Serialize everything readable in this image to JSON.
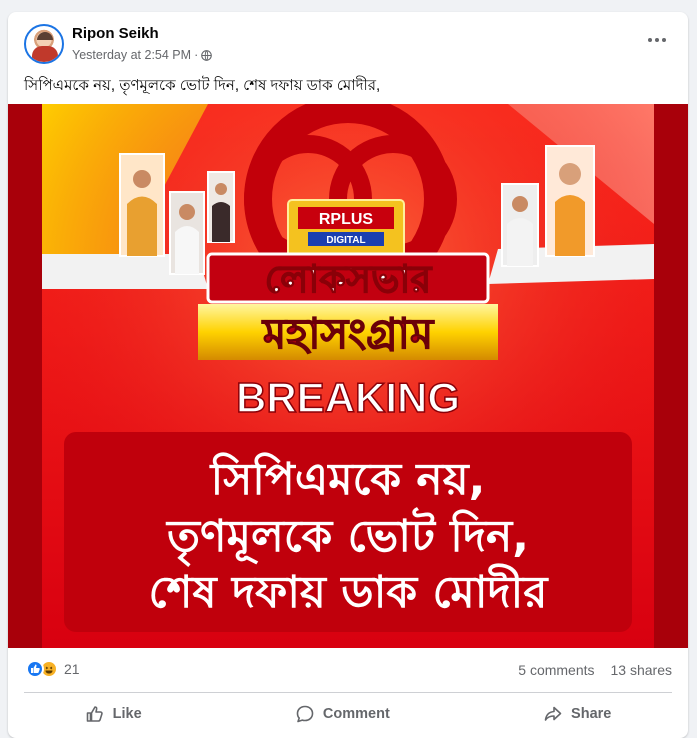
{
  "post": {
    "author": "Ripon Seikh",
    "timestamp": "Yesterday at 2:54 PM",
    "separator": "·",
    "audience_icon": "globe-icon",
    "caption": "সিপিএমকে নয়, তৃণমূলকে ভোট দিন, শেষ দফায় ডাক মোদীর,"
  },
  "image": {
    "logo_top": "RPLUS",
    "logo_bottom": "DIGITAL",
    "title_line1": "লোকসভার",
    "title_line2": "মহাসংগ্রাম",
    "breaking": "BREAKING",
    "headline_line1": "সিপিএমকে নয়,",
    "headline_line2": "তৃণমূলকে ভোট দিন,",
    "headline_line3": "শেষ দফায় ডাক মোদীর",
    "colors": {
      "red": "#e3101b",
      "yellow": "#ffd200",
      "dark_red": "#a8000a"
    }
  },
  "stats": {
    "reaction_icons": [
      "like-icon",
      "haha-icon"
    ],
    "reaction_count": "21",
    "comments": "5 comments",
    "shares": "13 shares"
  },
  "actions": {
    "like": "Like",
    "comment": "Comment",
    "share": "Share"
  }
}
